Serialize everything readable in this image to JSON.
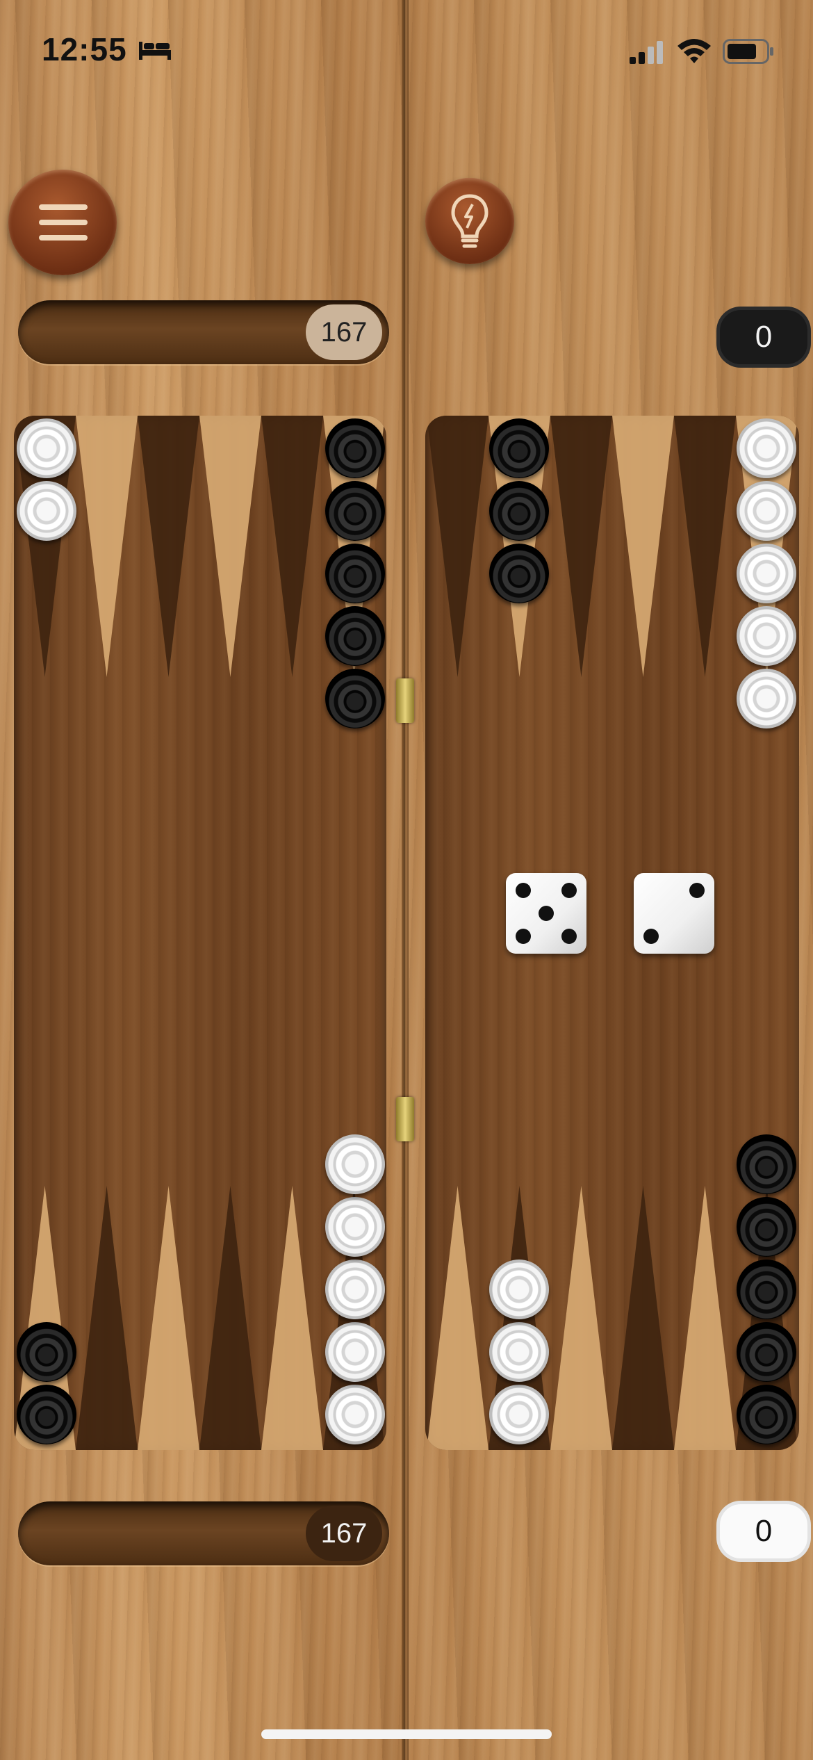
{
  "status_bar": {
    "time": "12:55"
  },
  "players": {
    "top": {
      "pip_count": "167",
      "score": "0",
      "color": "white"
    },
    "bottom": {
      "pip_count": "167",
      "score": "0",
      "color": "black"
    }
  },
  "dice": [
    5,
    2
  ],
  "board": {
    "top_left_points": [
      {
        "count": 2,
        "color": "white"
      },
      {
        "count": 0
      },
      {
        "count": 0
      },
      {
        "count": 0
      },
      {
        "count": 0
      },
      {
        "count": 5,
        "color": "black"
      }
    ],
    "top_right_points": [
      {
        "count": 0
      },
      {
        "count": 3,
        "color": "black"
      },
      {
        "count": 0
      },
      {
        "count": 0
      },
      {
        "count": 0
      },
      {
        "count": 5,
        "color": "white"
      }
    ],
    "bottom_left_points": [
      {
        "count": 2,
        "color": "black"
      },
      {
        "count": 0
      },
      {
        "count": 0
      },
      {
        "count": 0
      },
      {
        "count": 0
      },
      {
        "count": 5,
        "color": "white"
      }
    ],
    "bottom_right_points": [
      {
        "count": 0
      },
      {
        "count": 3,
        "color": "white"
      },
      {
        "count": 0
      },
      {
        "count": 0
      },
      {
        "count": 0
      },
      {
        "count": 5,
        "color": "black"
      }
    ]
  },
  "icons": {
    "menu": "hamburger-menu-icon",
    "hint": "lightbulb-icon",
    "status": [
      "bed-icon",
      "signal-icon",
      "wifi-icon",
      "battery-icon"
    ]
  },
  "colors": {
    "point_light": "#d9ac74",
    "point_dark": "#3e2410",
    "board": "#6f4422"
  }
}
